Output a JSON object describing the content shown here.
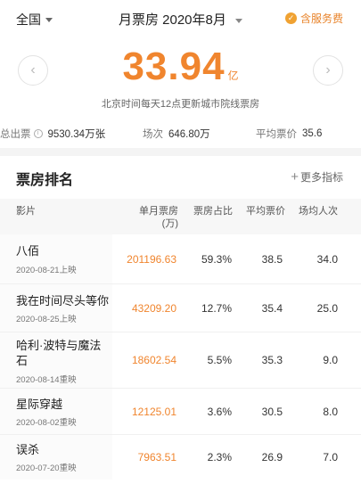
{
  "header": {
    "region": "全国",
    "period": "月票房 2020年8月",
    "service_toggle": "含服务费"
  },
  "summary": {
    "total_value": "33.94",
    "total_unit": "亿",
    "update_note": "北京时间每天12点更新城市院线票房",
    "prev_label": "‹",
    "next_label": "›"
  },
  "stats": {
    "admissions_label": "总出票",
    "admissions_value": "9530.34万张",
    "shows_label": "场次",
    "shows_value": "646.80万",
    "avg_price_label": "平均票价",
    "avg_price_value": "35.6"
  },
  "ranking": {
    "title": "票房排名",
    "more_label": "更多指标",
    "columns": {
      "film": "影片",
      "gross": "单月票房\n(万)",
      "share": "票房占比",
      "avg_price": "平均票价",
      "per_show": "场均人次"
    },
    "rows": [
      {
        "title": "八佰",
        "date": "2020-08-21上映",
        "gross": "201196.63",
        "share": "59.3%",
        "avg_price": "38.5",
        "per_show": "34.0"
      },
      {
        "title": "我在时间尽头等你",
        "date": "2020-08-25上映",
        "gross": "43209.20",
        "share": "12.7%",
        "avg_price": "35.4",
        "per_show": "25.0"
      },
      {
        "title": "哈利·波特与魔法石",
        "date": "2020-08-14重映",
        "gross": "18602.54",
        "share": "5.5%",
        "avg_price": "35.3",
        "per_show": "9.0"
      },
      {
        "title": "星际穿越",
        "date": "2020-08-02重映",
        "gross": "12125.01",
        "share": "3.6%",
        "avg_price": "30.5",
        "per_show": "8.0"
      },
      {
        "title": "误杀",
        "date": "2020-07-20重映",
        "gross": "7963.51",
        "share": "2.3%",
        "avg_price": "26.9",
        "per_show": "7.0"
      }
    ]
  },
  "colors": {
    "accent": "#f0852e",
    "service_icon": "#f0a232"
  }
}
